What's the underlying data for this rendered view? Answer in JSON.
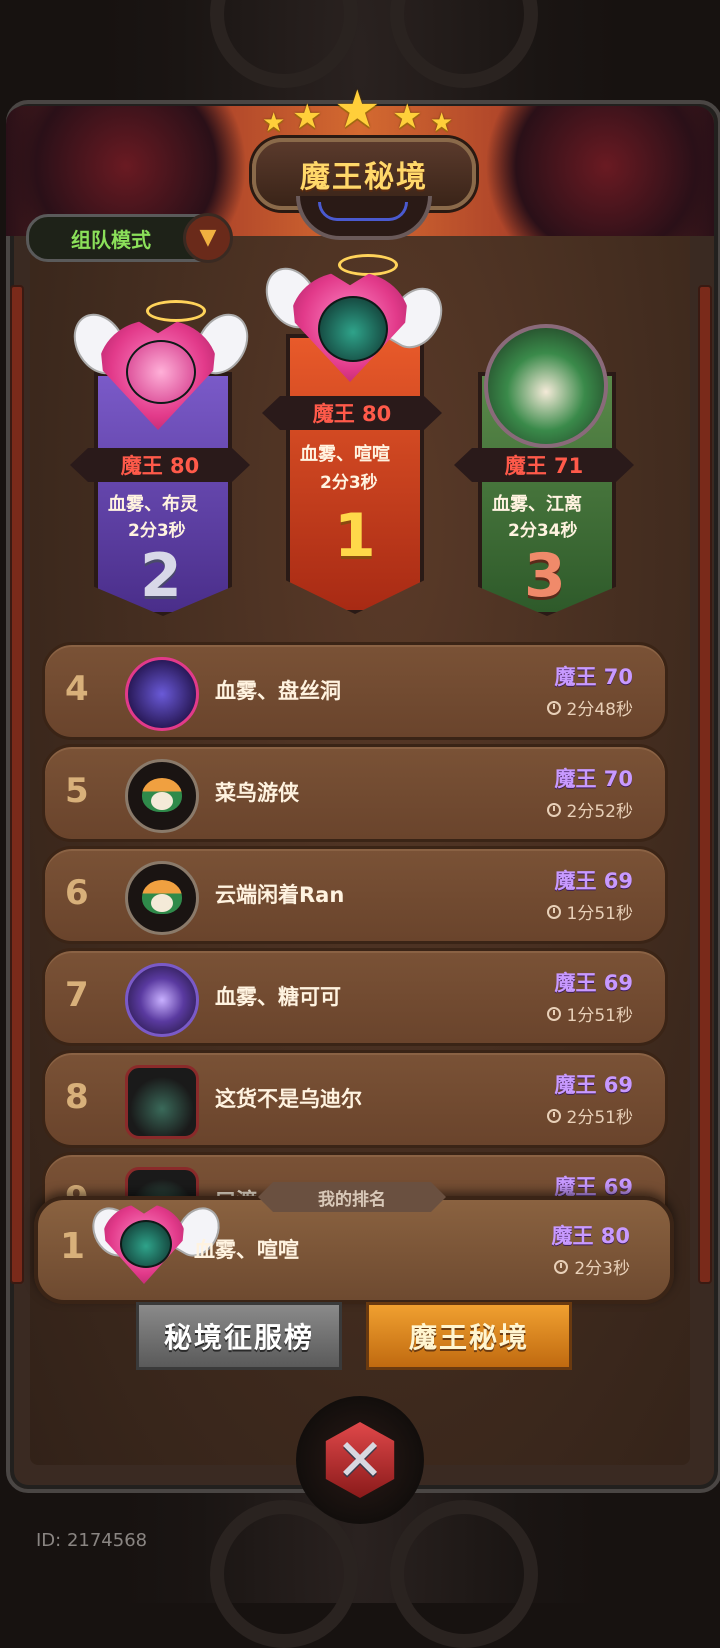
{
  "header": {
    "title": "魔王秘境",
    "stars": 5
  },
  "mode": {
    "label": "组队模式"
  },
  "podium": [
    {
      "rank": "2",
      "level": "魔王 80",
      "name": "血雾、布灵",
      "time": "2分3秒",
      "ribbon_color": "#5a3e9a"
    },
    {
      "rank": "1",
      "level": "魔王 80",
      "name": "血雾、喧喧",
      "time": "2分3秒",
      "ribbon_color": "#c8401e"
    },
    {
      "rank": "3",
      "level": "魔王 71",
      "name": "血雾、江离",
      "time": "2分34秒",
      "ribbon_color": "#3e6a3a"
    }
  ],
  "list": [
    {
      "rank": "4",
      "name": "血雾、盘丝洞",
      "level": "魔王 70",
      "time": "2分48秒"
    },
    {
      "rank": "5",
      "name": "菜鸟游侠",
      "level": "魔王 70",
      "time": "2分52秒"
    },
    {
      "rank": "6",
      "name": "云端闲着Ran",
      "level": "魔王 69",
      "time": "1分51秒"
    },
    {
      "rank": "7",
      "name": "血雾、糖可可",
      "level": "魔王 69",
      "time": "1分51秒"
    },
    {
      "rank": "8",
      "name": "这货不是乌迪尔",
      "level": "魔王 69",
      "time": "2分51秒"
    },
    {
      "rank": "9",
      "name": "口渡",
      "level": "魔王 69",
      "time": ""
    }
  ],
  "my_rank": {
    "tag": "我的排名",
    "rank": "1",
    "name": "血雾、喧喧",
    "level": "魔王 80",
    "time": "2分3秒"
  },
  "tabs": {
    "conquer": "秘境征服榜",
    "boss": "魔王秘境"
  },
  "user_id": "ID: 2174568",
  "colors": {
    "accent_gold": "#ffd86a",
    "level_red": "#ff5a4a",
    "level_purple": "#c89aff",
    "mode_green": "#8be05a"
  }
}
